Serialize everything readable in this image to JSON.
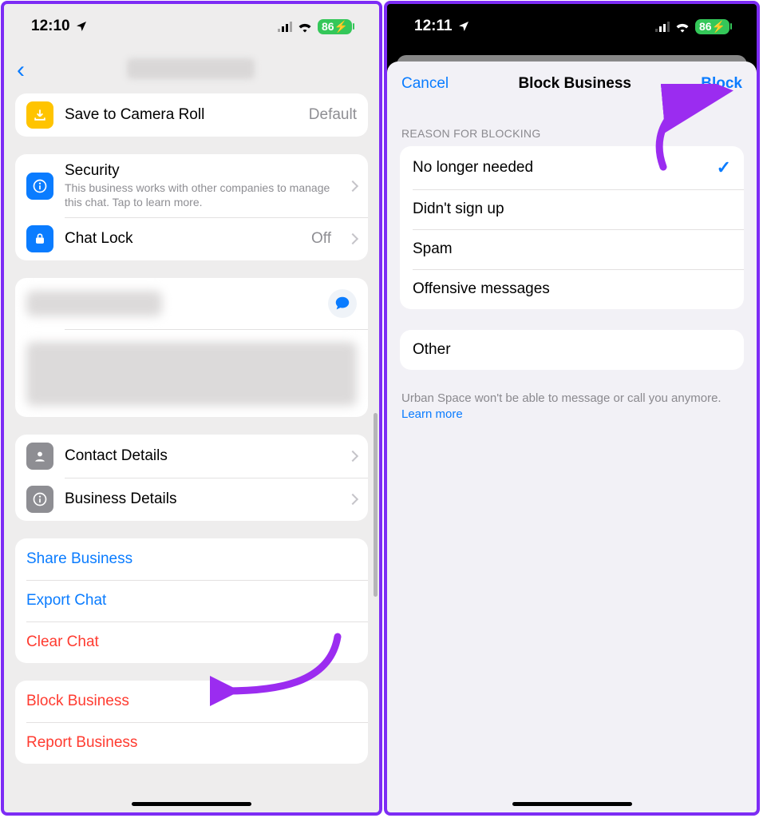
{
  "left": {
    "status": {
      "time": "12:10",
      "battery": "86"
    },
    "rows": {
      "saveCamera": {
        "label": "Save to Camera Roll",
        "trail": "Default"
      },
      "security": {
        "label": "Security",
        "sub": "This business works with other companies to manage this chat. Tap to learn more."
      },
      "chatlock": {
        "label": "Chat Lock",
        "trail": "Off"
      },
      "contact": {
        "label": "Contact Details"
      },
      "business": {
        "label": "Business Details"
      },
      "share": {
        "label": "Share Business"
      },
      "export": {
        "label": "Export Chat"
      },
      "clear": {
        "label": "Clear Chat"
      },
      "block": {
        "label": "Block Business"
      },
      "report": {
        "label": "Report Business"
      }
    }
  },
  "right": {
    "status": {
      "time": "12:11",
      "battery": "86"
    },
    "nav": {
      "cancel": "Cancel",
      "title": "Block Business",
      "block": "Block"
    },
    "sectionHeader": "REASON FOR BLOCKING",
    "reasons": {
      "r1": "No longer needed",
      "r2": "Didn't sign up",
      "r3": "Spam",
      "r4": "Offensive messages",
      "other": "Other"
    },
    "footnote": "Urban Space won't be able to message or call you anymore. ",
    "learnMore": "Learn more"
  }
}
